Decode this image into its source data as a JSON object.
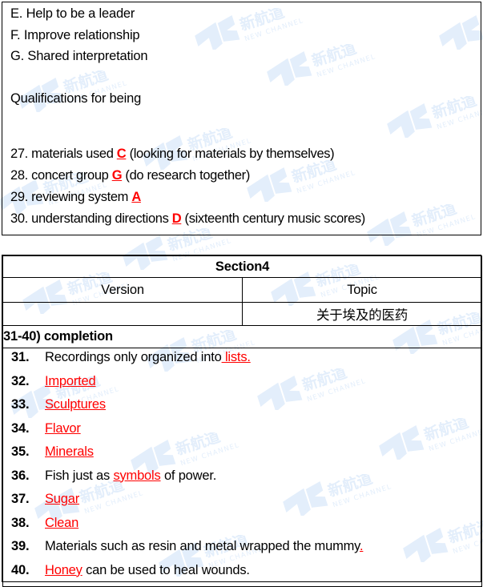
{
  "watermark": {
    "mark_cn": "新航道",
    "mark_en": "NEW CHANNEL",
    "badge": "NC",
    "color": "#e3eefb"
  },
  "colors": {
    "answer_red": "#ff0000",
    "text_black": "#000000",
    "border": "#000000"
  },
  "top_block": {
    "options": [
      "E. Help to be a leader",
      "F. Improve relationship",
      "G. Shared interpretation"
    ],
    "heading": "Qualifications for being",
    "questions": [
      {
        "num": "27.",
        "pre": "materials used ",
        "answer": "C",
        "post": " (looking for materials by themselves)"
      },
      {
        "num": "28.",
        "pre": "concert group ",
        "answer": "G",
        "post": " (do research together)"
      },
      {
        "num": "29.",
        "pre": "reviewing system ",
        "answer": "A",
        "post": ""
      },
      {
        "num": "30.",
        "pre": "understanding directions ",
        "answer": "D",
        "post": " (sixteenth century music scores)"
      }
    ]
  },
  "section_table": {
    "title": "Section4",
    "col_version": "Version",
    "col_topic": "Topic",
    "val_version": "",
    "val_topic": "关于埃及的医药",
    "completion_label": "31-40) completion",
    "answers": [
      {
        "num": "31.",
        "pre": "Recordings only organized into",
        "answer": " lists.",
        "post": ""
      },
      {
        "num": "32.",
        "pre": "",
        "answer": "Imported",
        "post": ""
      },
      {
        "num": "33.",
        "pre": "",
        "answer": "Sculptures",
        "post": ""
      },
      {
        "num": "34.",
        "pre": "",
        "answer": "Flavor",
        "post": ""
      },
      {
        "num": "35.",
        "pre": "",
        "answer": "Minerals",
        "post": ""
      },
      {
        "num": "36.",
        "pre": "Fish just as ",
        "answer": "symbols",
        "post": " of power."
      },
      {
        "num": "37.",
        "pre": "",
        "answer": "Sugar",
        "post": ""
      },
      {
        "num": "38.",
        "pre": "",
        "answer": "Clean",
        "post": ""
      },
      {
        "num": "39.",
        "pre": "Materials such as resin and metal wrapped the mummy",
        "answer": ".",
        "post": ""
      },
      {
        "num": "40.",
        "pre": "",
        "answer": "Honey",
        "post": " can be used to heal wounds."
      }
    ]
  }
}
